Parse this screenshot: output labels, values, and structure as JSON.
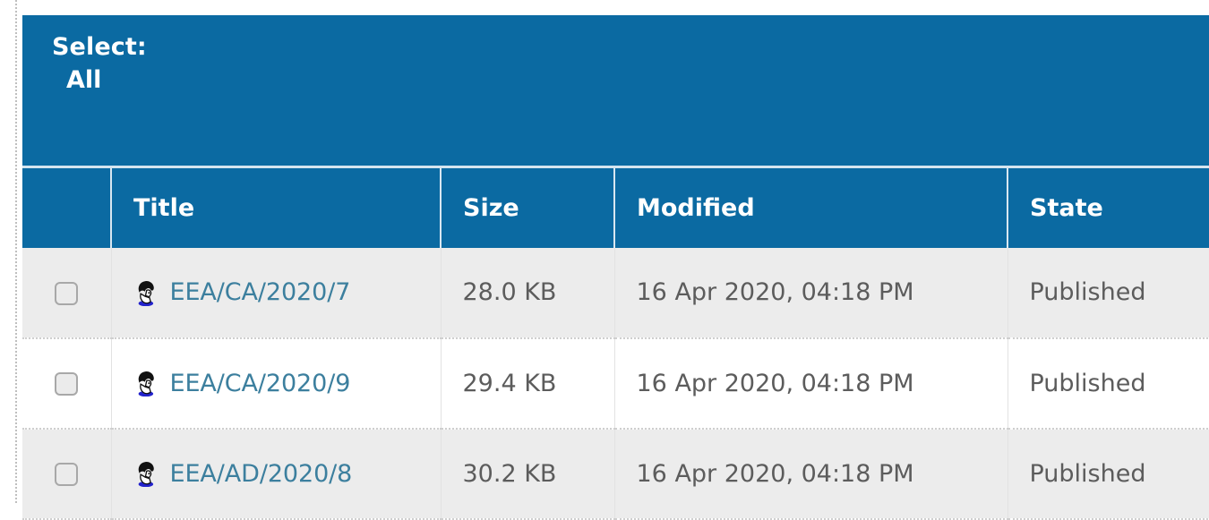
{
  "select_bar": {
    "label": "Select:",
    "options": [
      {
        "label": "All",
        "name": "select-all"
      }
    ]
  },
  "table": {
    "columns": [
      {
        "key": "checkbox",
        "label": ""
      },
      {
        "key": "title",
        "label": "Title"
      },
      {
        "key": "size",
        "label": "Size"
      },
      {
        "key": "modified",
        "label": "Modified"
      },
      {
        "key": "state",
        "label": "State"
      }
    ],
    "rows": [
      {
        "checked": false,
        "icon": "person-icon",
        "title": "EEA/CA/2020/7",
        "size": "28.0 KB",
        "modified": "16 Apr 2020, 04:18 PM",
        "state": "Published"
      },
      {
        "checked": false,
        "icon": "person-icon",
        "title": "EEA/CA/2020/9",
        "size": "29.4 KB",
        "modified": "16 Apr 2020, 04:18 PM",
        "state": "Published"
      },
      {
        "checked": false,
        "icon": "person-icon",
        "title": "EEA/AD/2020/8",
        "size": "30.2 KB",
        "modified": "16 Apr 2020, 04:18 PM",
        "state": "Published"
      }
    ]
  },
  "colors": {
    "header_background": "#0b6aa2",
    "header_text": "#ffffff",
    "link_text": "#3c7f9e",
    "body_text": "#5c5c5c",
    "row_odd_background": "#ececec",
    "row_even_background": "#ffffff"
  }
}
